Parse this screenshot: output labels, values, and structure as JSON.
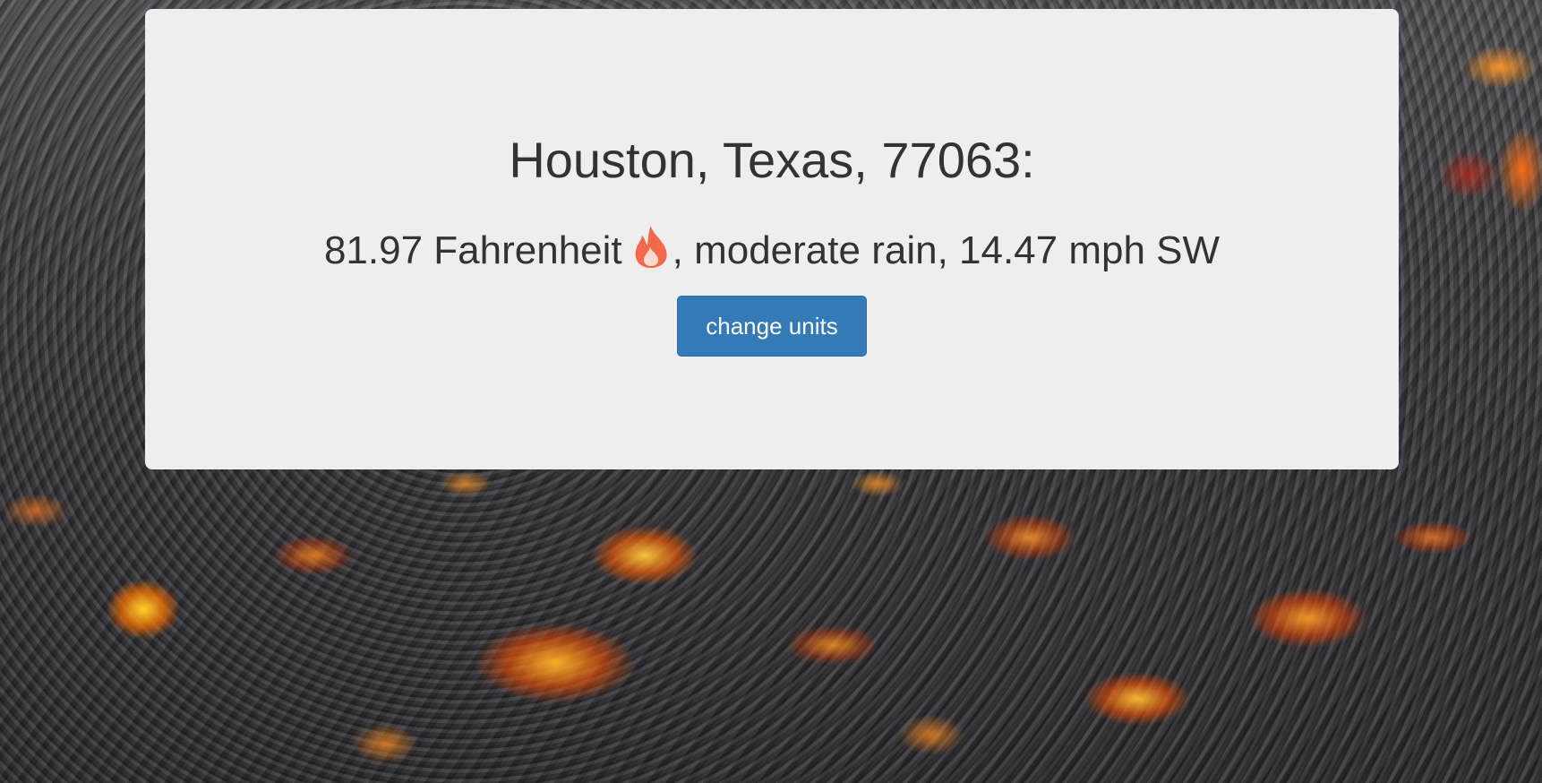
{
  "weather": {
    "location": "Houston, Texas, 77063:",
    "temperature": "81.97 Fahrenheit",
    "temperature_icon": "fire-icon",
    "rest": ", moderate rain, 14.47 mph SW"
  },
  "controls": {
    "change_units_label": "change units"
  },
  "colors": {
    "panel_bg": "#eeeeee",
    "text": "#333333",
    "button_bg": "#337ab7",
    "icon": "#f26a4b"
  }
}
